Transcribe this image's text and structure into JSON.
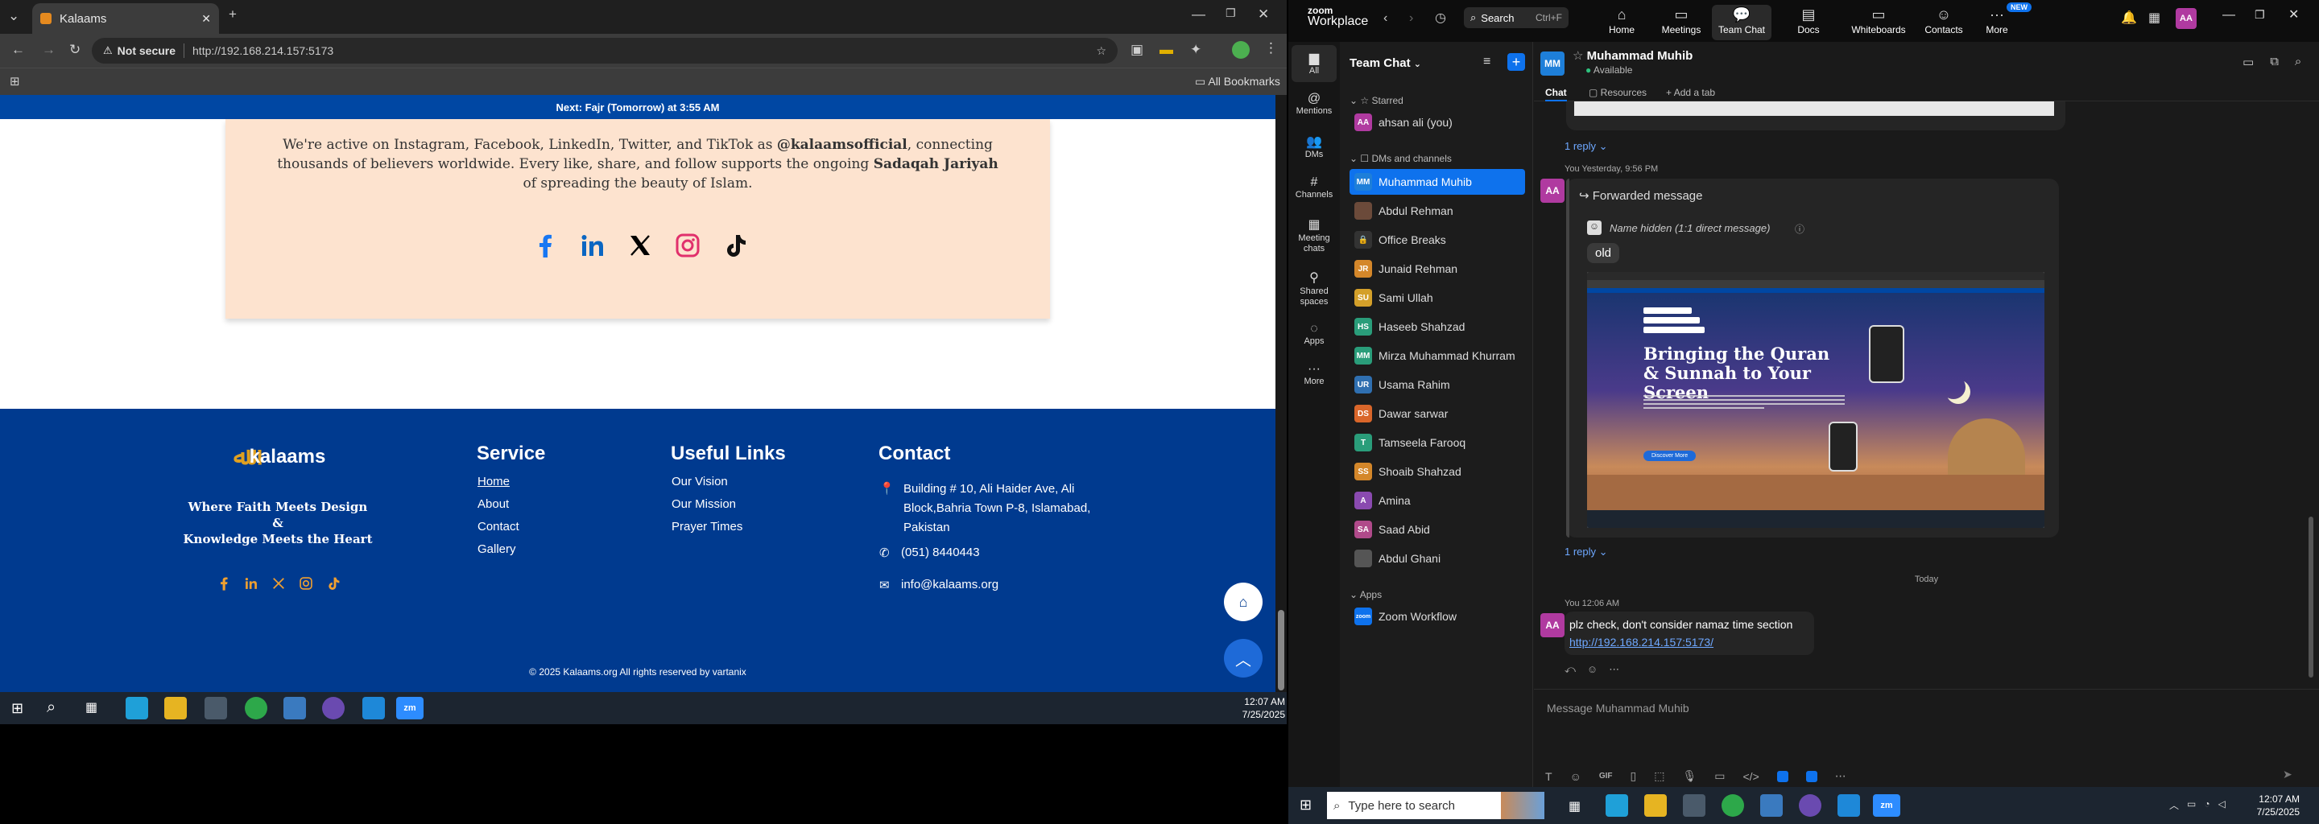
{
  "browser": {
    "tab_title": "Kalaams",
    "not_secure": "Not secure",
    "url": "http://192.168.214.157:5173",
    "all_bookmarks": "All Bookmarks",
    "prayer_bar": "Next: Fajr (Tomorrow) at 3:55 AM",
    "card_text_1": "We're active on Instagram, Facebook, LinkedIn, Twitter, and TikTok as ",
    "card_handle": "@kalaamsofficial",
    "card_text_2": ", connecting thousands of believers worldwide. Every like, share, and follow supports the ongoing ",
    "card_sadaqah": "Sadaqah Jariyah",
    "card_text_3": " of spreading the beauty of Islam.",
    "footer": {
      "logo": "kalaams",
      "tagline_1": "Where Faith Meets Design",
      "tagline_amp": "&",
      "tagline_2": "Knowledge Meets the Heart",
      "service_heading": "Service",
      "service_links": [
        "Home",
        "About",
        "Contact",
        "Gallery"
      ],
      "useful_heading": "Useful Links",
      "useful_links": [
        "Our Vision",
        "Our Mission",
        "Prayer Times"
      ],
      "contact_heading": "Contact",
      "address": "Building # 10, Ali Haider Ave, Ali Block,Bahria Town P-8, Islamabad, Pakistan",
      "phone": "(051) 8440443",
      "email": "info@kalaams.org",
      "copyright": "© 2025 Kalaams.org All rights reserved by vartanix"
    },
    "clock_time": "12:07 AM",
    "clock_date": "7/25/2025"
  },
  "zoom": {
    "brand_small": "zoom",
    "brand": "Workplace",
    "search_label": "Search",
    "search_shortcut": "Ctrl+F",
    "nav": [
      "Home",
      "Meetings",
      "Team Chat",
      "Docs",
      "Whiteboards",
      "Contacts",
      "More"
    ],
    "new_badge": "NEW",
    "user_initials": "AA",
    "rail": [
      "All",
      "Mentions",
      "DMs",
      "Channels",
      "Meeting chats",
      "Shared spaces",
      "Apps",
      "More"
    ],
    "panel_title": "Team Chat",
    "starred": "Starred",
    "self_name": "ahsan ali (you)",
    "dms_heading": "DMs and channels",
    "contacts": [
      {
        "initials": "MM",
        "name": "Muhammad Muhib",
        "color": "#1e7fd9"
      },
      {
        "initials": "",
        "name": "Abdul Rehman",
        "color": "#6b4a3a"
      },
      {
        "initials": "🔒",
        "name": "Office Breaks",
        "color": "#333333"
      },
      {
        "initials": "JR",
        "name": "Junaid Rehman",
        "color": "#d4872a"
      },
      {
        "initials": "SU",
        "name": "Sami Ullah",
        "color": "#d4a02a"
      },
      {
        "initials": "HS",
        "name": "Haseeb Shahzad",
        "color": "#2a9d7a"
      },
      {
        "initials": "MM",
        "name": "Mirza Muhammad Khurram",
        "color": "#2a9d7a"
      },
      {
        "initials": "UR",
        "name": "Usama Rahim",
        "color": "#2f6fb0"
      },
      {
        "initials": "DS",
        "name": "Dawar sarwar",
        "color": "#d9662a"
      },
      {
        "initials": "T",
        "name": "Tamseela Farooq",
        "color": "#2a9d7a"
      },
      {
        "initials": "SS",
        "name": "Shoaib Shahzad",
        "color": "#d4872a"
      },
      {
        "initials": "A",
        "name": "Amina",
        "color": "#8a4ab0"
      },
      {
        "initials": "SA",
        "name": "Saad Abid",
        "color": "#b04a8a"
      },
      {
        "initials": "",
        "name": "Abdul Ghani",
        "color": "#555555"
      }
    ],
    "apps_heading": "Apps",
    "zoom_workflow": "Zoom Workflow",
    "chat_name": "Muhammad Muhib",
    "chat_status": "Available",
    "tabs": [
      "Chat",
      "Resources",
      "Add a tab"
    ],
    "reply_1": "1 reply",
    "msg1_meta": "You Yesterday, 9:56 PM",
    "forwarded": "Forwarded message",
    "name_hidden": "Name hidden (1:1 direct message)",
    "old": "old",
    "preview_title": "Bringing the Quran & Sunnah to Your Screen",
    "preview_btn": "Discover More",
    "reply_2": "1 reply",
    "today": "Today",
    "msg2_meta": "You 12:06 AM",
    "msg2_text": "plz check, don't consider namaz time section",
    "msg2_link": "http://192.168.214.157:5173/",
    "compose_placeholder": "Message Muhammad Muhib",
    "taskbar_search": "Type here to search",
    "clock_time": "12:07 AM",
    "clock_date": "7/25/2025"
  },
  "colors": {
    "brand_blue": "#0047a3",
    "footer_blue": "#003a8f",
    "card_peach": "#fde3cf",
    "zoom_accent": "#0e72ed"
  }
}
